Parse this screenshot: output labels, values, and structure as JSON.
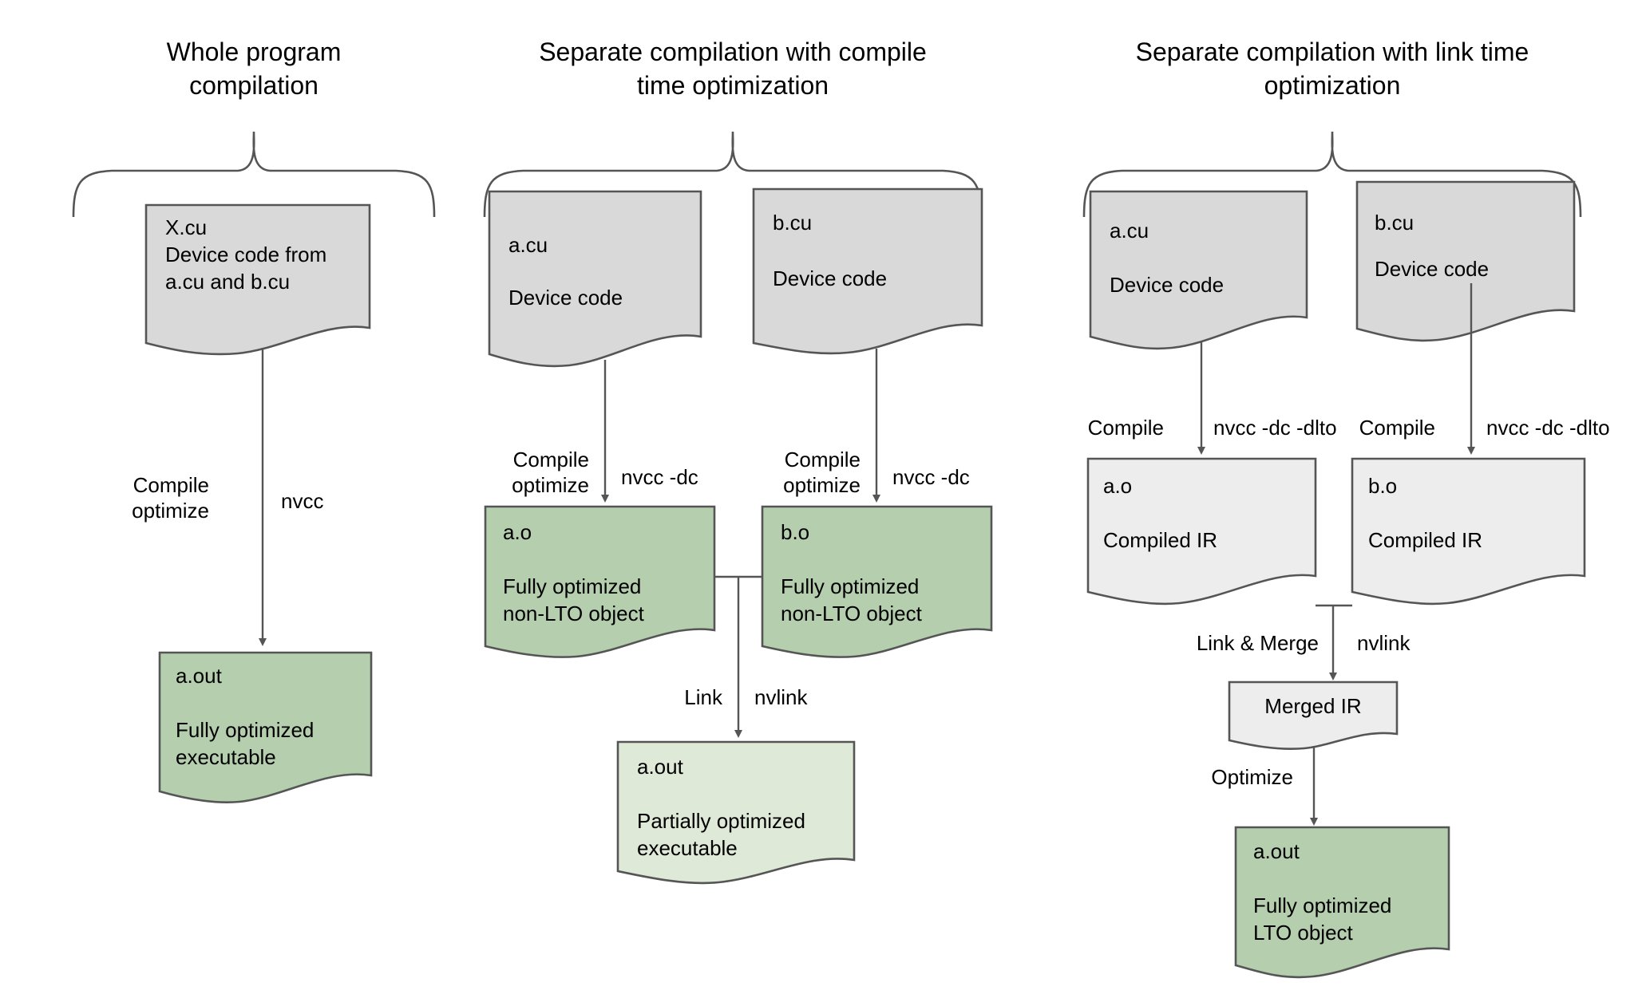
{
  "diagram": {
    "title_semantics": "nvcc compilation modes comparison",
    "colors": {
      "source_fill": "#d9d9d9",
      "object_fill_green": "#b4ceae",
      "object_fill_green_light": "#dfe9d7",
      "ir_fill": "#ededed",
      "stroke": "#555555",
      "text": "#000000",
      "background": "#ffffff"
    }
  },
  "columns": [
    {
      "id": "whole-program",
      "title": "Whole program\ncompilation",
      "nodes": [
        {
          "id": "x-cu",
          "name": "X.cu",
          "desc": "Device code from\na.cu and b.cu",
          "fill": "source_fill"
        },
        {
          "id": "a-out",
          "name": "a.out",
          "desc": "Fully optimized\nexecutable",
          "fill": "object_fill_green"
        }
      ],
      "edges": [
        {
          "id": "compile-nvcc",
          "left_label": "Compile\noptimize",
          "right_label": "nvcc"
        }
      ]
    },
    {
      "id": "separate-compile-time-opt",
      "title": "Separate compilation with compile\ntime optimization",
      "nodes": [
        {
          "id": "a-cu",
          "name": "a.cu",
          "desc": "Device code",
          "fill": "source_fill"
        },
        {
          "id": "b-cu",
          "name": "b.cu",
          "desc": "Device code",
          "fill": "source_fill"
        },
        {
          "id": "a-o",
          "name": "a.o",
          "desc": "Fully optimized\nnon-LTO object",
          "fill": "object_fill_green"
        },
        {
          "id": "b-o",
          "name": "b.o",
          "desc": "Fully optimized\nnon-LTO object",
          "fill": "object_fill_green"
        },
        {
          "id": "a-out",
          "name": "a.out",
          "desc": "Partially optimized\nexecutable",
          "fill": "object_fill_green_light"
        }
      ],
      "edges": [
        {
          "id": "a-compile",
          "left_label": "Compile\noptimize",
          "right_label": "nvcc -dc"
        },
        {
          "id": "b-compile",
          "left_label": "Compile\noptimize",
          "right_label": "nvcc -dc"
        },
        {
          "id": "link",
          "left_label": "Link",
          "right_label": "nvlink"
        }
      ]
    },
    {
      "id": "separate-link-time-opt",
      "title": "Separate compilation with link time\noptimization",
      "nodes": [
        {
          "id": "a-cu",
          "name": "a.cu",
          "desc": "Device code",
          "fill": "source_fill"
        },
        {
          "id": "b-cu",
          "name": "b.cu",
          "desc": "Device code",
          "fill": "source_fill"
        },
        {
          "id": "a-o",
          "name": "a.o",
          "desc": "Compiled IR",
          "fill": "ir_fill"
        },
        {
          "id": "b-o",
          "name": "b.o",
          "desc": "Compiled IR",
          "fill": "ir_fill"
        },
        {
          "id": "merged-ir",
          "name": "Merged IR",
          "desc": "",
          "fill": "ir_fill"
        },
        {
          "id": "a-out",
          "name": "a.out",
          "desc": "Fully optimized\nLTO object",
          "fill": "object_fill_green"
        }
      ],
      "edges": [
        {
          "id": "a-compile",
          "left_label": "Compile",
          "right_label": "nvcc -dc -dlto"
        },
        {
          "id": "b-compile",
          "left_label": "Compile",
          "right_label": "nvcc -dc -dlto"
        },
        {
          "id": "link-merge",
          "left_label": "Link & Merge",
          "right_label": "nvlink"
        },
        {
          "id": "optimize",
          "left_label": "Optimize",
          "right_label": ""
        }
      ]
    }
  ]
}
